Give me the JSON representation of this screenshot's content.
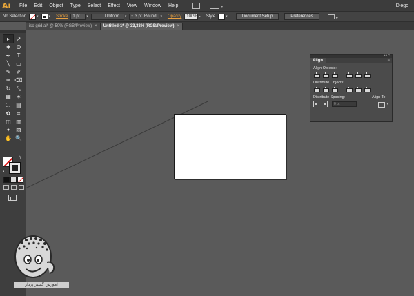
{
  "app": {
    "logo": "Ai",
    "user": "Diego"
  },
  "menu": [
    "File",
    "Edit",
    "Object",
    "Type",
    "Select",
    "Effect",
    "View",
    "Window",
    "Help"
  ],
  "control": {
    "selection": "No Selection",
    "stroke_label": "Stroke",
    "stroke_weight": "1 pt",
    "profile": "Uniform",
    "brush": "3 pt. Round",
    "opacity_label": "Opacity",
    "opacity_value": "100%",
    "style_label": "Style",
    "document_setup": "Document Setup",
    "preferences": "Preferences"
  },
  "tabs": [
    {
      "label": "iso grid.ai* @ 50% (RGB/Preview)",
      "close": "×"
    },
    {
      "label": "Untitled-1* @ 33,33% (RGB/Preview)",
      "close": "×"
    }
  ],
  "align_panel": {
    "tab": "Align",
    "menu_icon": "≡",
    "align_objects": "Align Objects:",
    "distribute_objects": "Distribute Objects:",
    "distribute_spacing": "Distribute Spacing:",
    "align_to": "Align To:",
    "spacing_value": "0 pt"
  },
  "tools": [
    "▸",
    "↗",
    "✱",
    "ʘ",
    "✒",
    "T",
    "╲",
    "▭",
    "✎",
    "✐",
    "✂",
    "⌫",
    "↻",
    "⤡",
    "▦",
    "✶",
    "⛶",
    "▤",
    "✿",
    "⌗",
    "◫",
    "▥",
    "✦",
    "▨",
    "✋",
    "🔍"
  ],
  "watermark": {
    "caption": "آموزش گستر پرداز"
  },
  "colors": {
    "accent": "#e8a040",
    "canvas": "#5a5a5a",
    "artboard": "#ffffff"
  }
}
